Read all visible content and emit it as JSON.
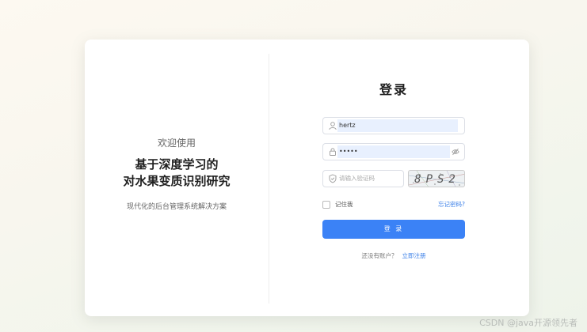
{
  "left_panel": {
    "welcome": "欢迎使用",
    "title_line1": "基于深度学习的",
    "title_line2": "对水果变质识别研究",
    "subtitle": "现代化的后台管理系统解决方案"
  },
  "login": {
    "title": "登录",
    "username_value": "hertz",
    "password_value": "•••••",
    "code_placeholder": "请输入验证码",
    "captcha_text": "8PS2",
    "remember_label": "记住我",
    "forgot_label": "忘记密码?",
    "submit_label": "登 录",
    "register_prompt": "还没有账户？",
    "register_link": "立即注册"
  },
  "colors": {
    "primary": "#3b82f6",
    "link": "#3a7fe8",
    "autofill": "#e8f0fe"
  },
  "watermark": "CSDN @java开源领先者"
}
